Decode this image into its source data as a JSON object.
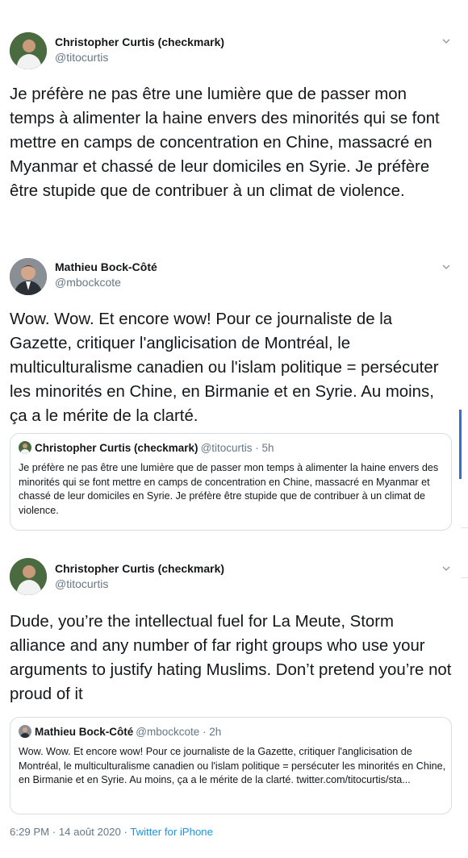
{
  "tweets": [
    {
      "name": "Christopher Curtis (checkmark)",
      "handle": "@titocurtis",
      "text": "Je préfère ne pas être une lumière que de passer mon temps à alimenter la haine envers des minorités qui se font mettre en camps de concentration en Chine, massacré en Myanmar et chassé de leur domiciles en Syrie. Je préfère être stupide que de contribuer à un climat de violence."
    },
    {
      "name": "Mathieu Bock-Côté",
      "handle": "@mbockcote",
      "text": "Wow. Wow. Et encore wow! Pour ce journaliste de la Gazette, critiquer l'anglicisation de Montréal, le multiculturalisme canadien ou l'islam politique = persécuter les minorités en Chine, en Birmanie et en Syrie. Au moins, ça a le mérite de la clarté.",
      "quote": {
        "name": "Christopher Curtis (checkmark)",
        "meta": "@titocurtis · 5h",
        "text": "Je préfère ne pas être une lumière que de passer mon temps à alimenter la haine envers des minorités qui se font mettre en camps de concentration en Chine, massacré en Myanmar et chassé de leur domiciles en Syrie. Je préfère être stupide que de contribuer à un climat de violence."
      }
    },
    {
      "name": "Christopher Curtis (checkmark)",
      "handle": "@titocurtis",
      "text": "Dude, you’re the intellectual fuel for La Meute, Storm alliance  and any number of far right groups who use your arguments to justify hating Muslims. Don’t pretend  you’re not proud of it",
      "quote": {
        "name": "Mathieu Bock-Côté",
        "meta": "@mbockcote · 2h",
        "text": "Wow. Wow. Et encore wow! Pour ce journaliste de la Gazette, critiquer l'anglicisation de Montréal, le multiculturalisme canadien ou l'islam politique = persécuter les minorités en Chine, en Birmanie et en Syrie. Au moins, ça a le mérite de la clarté. twitter.com/titocurtis/sta..."
      },
      "timestamp": "6:29 PM · 14 août 2020 ·",
      "source": "Twitter for iPhone"
    }
  ],
  "colors": {
    "link": "#1b95e0",
    "muted": "#657786",
    "border": "#d9dee3"
  },
  "icons": {
    "menu": "chevron-down-icon",
    "avatar": "avatar-photo"
  }
}
